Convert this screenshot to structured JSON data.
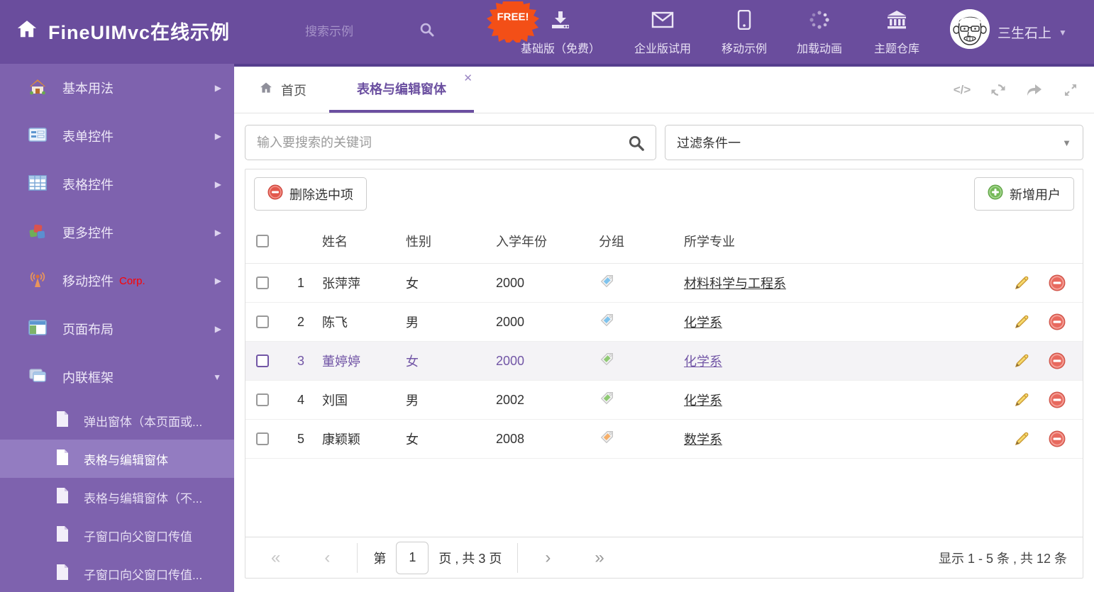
{
  "header": {
    "title": "FineUIMvc在线示例",
    "search_placeholder": "搜索示例",
    "free_badge": "FREE!",
    "nav_items": [
      {
        "label": "基础版（免费）",
        "icon": "download-icon"
      },
      {
        "label": "企业版试用",
        "icon": "envelope-icon"
      },
      {
        "label": "移动示例",
        "icon": "mobile-icon"
      },
      {
        "label": "加载动画",
        "icon": "spinner-icon"
      },
      {
        "label": "主题仓库",
        "icon": "bank-icon"
      }
    ],
    "username": "三生石上"
  },
  "sidebar": {
    "items": [
      {
        "label": "基本用法"
      },
      {
        "label": "表单控件"
      },
      {
        "label": "表格控件"
      },
      {
        "label": "更多控件"
      },
      {
        "label": "移动控件",
        "badge": "Corp."
      },
      {
        "label": "页面布局"
      },
      {
        "label": "内联框架",
        "expanded": true
      }
    ],
    "subitems": [
      {
        "label": "弹出窗体（本页面或..."
      },
      {
        "label": "表格与编辑窗体",
        "selected": true
      },
      {
        "label": "表格与编辑窗体（不..."
      },
      {
        "label": "子窗口向父窗口传值"
      },
      {
        "label": "子窗口向父窗口传值..."
      }
    ]
  },
  "tabs": {
    "home": "首页",
    "active": "表格与编辑窗体"
  },
  "filters": {
    "search_placeholder": "输入要搜索的关键词",
    "filter_value": "过滤条件一"
  },
  "toolbar": {
    "delete_label": "删除选中项",
    "add_label": "新增用户"
  },
  "table": {
    "columns": {
      "name": "姓名",
      "gender": "性别",
      "year": "入学年份",
      "group": "分组",
      "major": "所学专业"
    },
    "rows": [
      {
        "num": "1",
        "name": "张萍萍",
        "gender": "女",
        "year": "2000",
        "tag_color": "blue",
        "major": "材料科学与工程系",
        "selected": false
      },
      {
        "num": "2",
        "name": "陈飞",
        "gender": "男",
        "year": "2000",
        "tag_color": "blue",
        "major": "化学系",
        "selected": false
      },
      {
        "num": "3",
        "name": "董婷婷",
        "gender": "女",
        "year": "2000",
        "tag_color": "green",
        "major": "化学系",
        "selected": true
      },
      {
        "num": "4",
        "name": "刘国",
        "gender": "男",
        "year": "2002",
        "tag_color": "green",
        "major": "化学系",
        "selected": false
      },
      {
        "num": "5",
        "name": "康颖颖",
        "gender": "女",
        "year": "2008",
        "tag_color": "orange",
        "major": "数学系",
        "selected": false
      }
    ]
  },
  "pagination": {
    "page_prefix": "第",
    "page_value": "1",
    "page_suffix": "页 , 共 3 页",
    "summary": "显示 1 - 5 条 , 共 12 条"
  },
  "colors": {
    "header_bg": "#6a4d9d",
    "sidebar_bg": "#7e62ae",
    "accent": "#6b4fa0",
    "free_badge": "#f34f17",
    "tag_blue": "#7ec3ed",
    "tag_green": "#8fc974",
    "tag_orange": "#f5af6a"
  }
}
